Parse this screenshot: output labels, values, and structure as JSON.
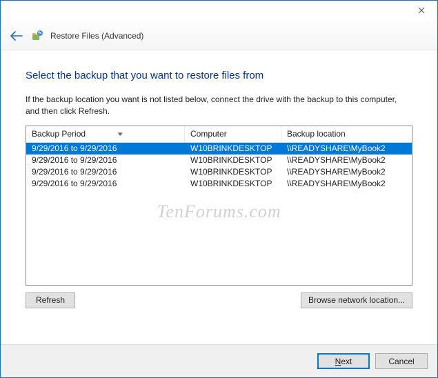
{
  "window": {
    "title": "Restore Files (Advanced)"
  },
  "heading": "Select the backup that you want to restore files from",
  "instruction": "If the backup location you want is not listed below, connect the drive with the backup to this computer, and then click Refresh.",
  "columns": {
    "period": "Backup Period",
    "computer": "Computer",
    "location": "Backup location"
  },
  "rows": [
    {
      "period": "9/29/2016 to 9/29/2016",
      "computer": "W10BRINKDESKTOP",
      "location": "\\\\READYSHARE\\MyBook2",
      "selected": true
    },
    {
      "period": "9/29/2016 to 9/29/2016",
      "computer": "W10BRINKDESKTOP",
      "location": "\\\\READYSHARE\\MyBook2",
      "selected": false
    },
    {
      "period": "9/29/2016 to 9/29/2016",
      "computer": "W10BRINKDESKTOP",
      "location": "\\\\READYSHARE\\MyBook2",
      "selected": false
    },
    {
      "period": "9/29/2016 to 9/29/2016",
      "computer": "W10BRINKDESKTOP",
      "location": "\\\\READYSHARE\\MyBook2",
      "selected": false
    }
  ],
  "buttons": {
    "refresh": "Refresh",
    "browse": "Browse network location...",
    "next": "Next",
    "cancel": "Cancel"
  },
  "watermark": "TenForums.com"
}
